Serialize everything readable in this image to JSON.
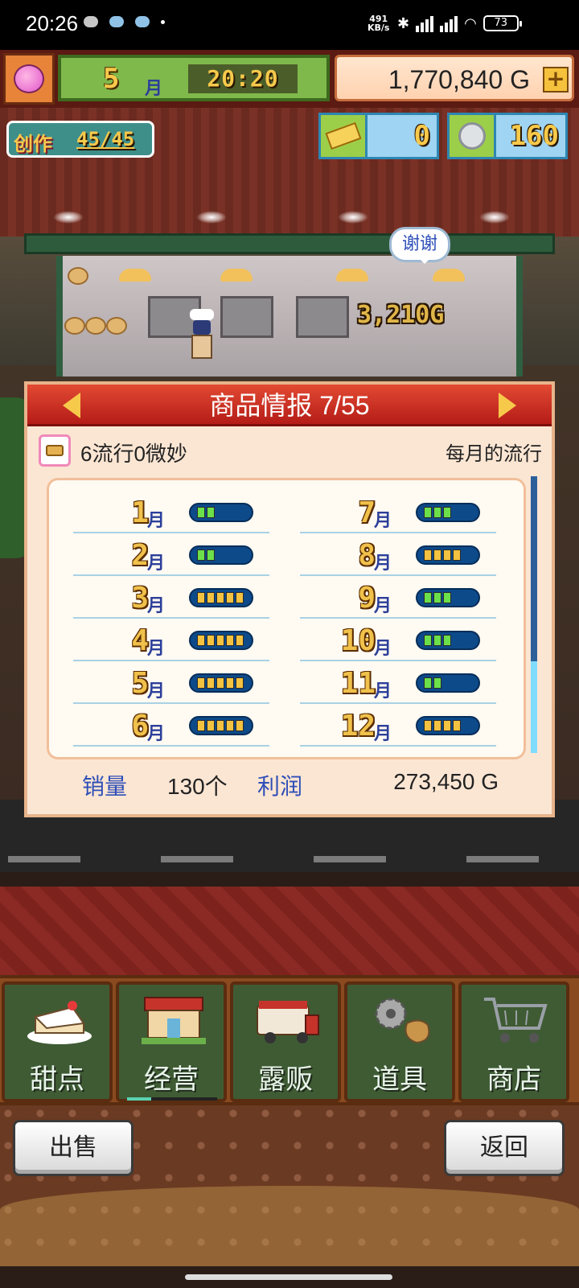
{
  "status_bar": {
    "time": "20:26",
    "net_speed_top": "491",
    "net_speed_bottom": "KB/s",
    "battery": "73",
    "network": "HD"
  },
  "hud": {
    "month": "5",
    "month_unit": "月",
    "clock": "20:20",
    "gold": "1,770,840 G",
    "gold_plus": "+",
    "create_label": "创作",
    "create_count": "45/45",
    "gold_bars": "0",
    "silver_coins": "160"
  },
  "scene": {
    "thanks_bubble": "谢谢",
    "floating_price": "3,210G"
  },
  "panel": {
    "title": "商品情报 7/55",
    "trend_text": "6流行0微妙",
    "trend_right": "每月的流行",
    "months": [
      {
        "num": "1",
        "unit": "月",
        "level": 2,
        "color": "green"
      },
      {
        "num": "2",
        "unit": "月",
        "level": 2,
        "color": "green"
      },
      {
        "num": "3",
        "unit": "月",
        "level": 5,
        "color": "yellow"
      },
      {
        "num": "4",
        "unit": "月",
        "level": 5,
        "color": "yellow"
      },
      {
        "num": "5",
        "unit": "月",
        "level": 5,
        "color": "yellow"
      },
      {
        "num": "6",
        "unit": "月",
        "level": 5,
        "color": "yellow"
      },
      {
        "num": "7",
        "unit": "月",
        "level": 3,
        "color": "green"
      },
      {
        "num": "8",
        "unit": "月",
        "level": 4,
        "color": "yellow"
      },
      {
        "num": "9",
        "unit": "月",
        "level": 3,
        "color": "green"
      },
      {
        "num": "10",
        "unit": "月",
        "level": 3,
        "color": "green"
      },
      {
        "num": "11",
        "unit": "月",
        "level": 2,
        "color": "green"
      },
      {
        "num": "12",
        "unit": "月",
        "level": 4,
        "color": "yellow"
      }
    ],
    "sales_label": "销量",
    "sales_value": "130个",
    "profit_label": "利润",
    "profit_value": "273,450 G"
  },
  "nav": {
    "items": [
      {
        "label": "甜点",
        "icon": "cake-icon"
      },
      {
        "label": "经营",
        "icon": "shop-icon"
      },
      {
        "label": "露贩",
        "icon": "food-truck-icon"
      },
      {
        "label": "道具",
        "icon": "items-icon"
      },
      {
        "label": "商店",
        "icon": "cart-icon"
      }
    ],
    "active_index": 1
  },
  "buttons": {
    "sell": "出售",
    "back": "返回"
  },
  "colors": {
    "panel_header": "#c5251d",
    "bar_green": "#6be04a",
    "bar_yellow": "#f4c241",
    "label_blue": "#2f4fb8"
  }
}
